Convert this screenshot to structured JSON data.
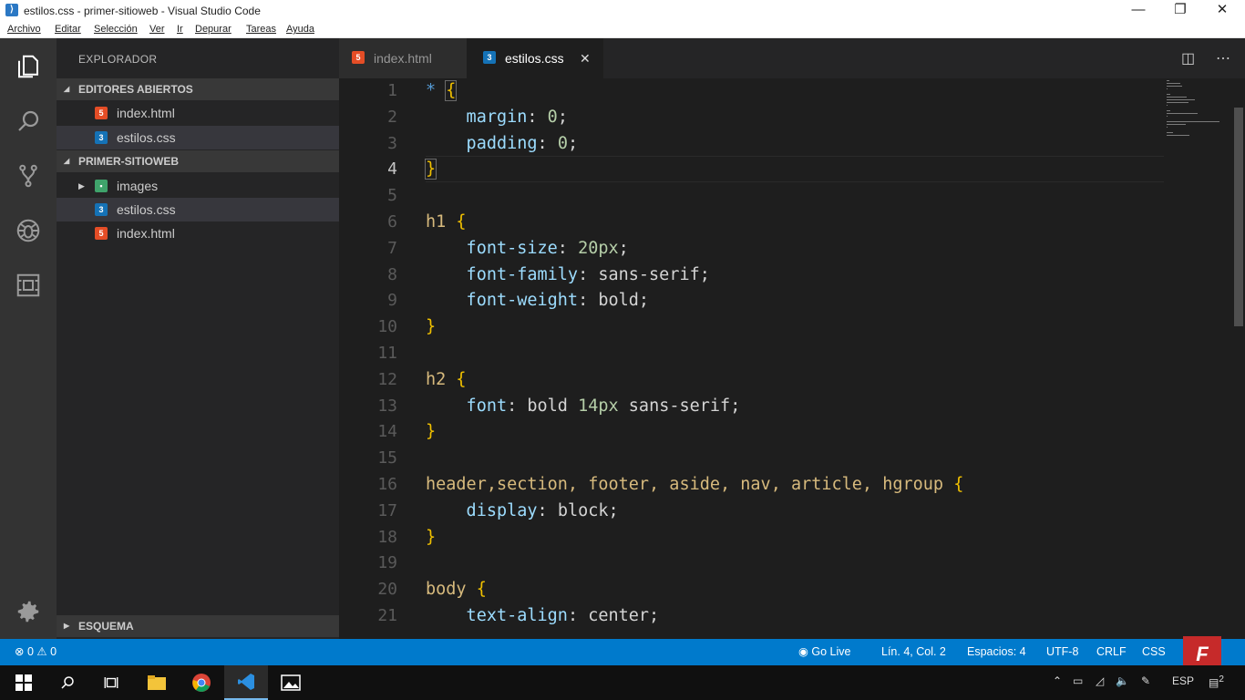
{
  "window": {
    "title": "estilos.css - primer-sitioweb - Visual Studio Code",
    "app_icon": "vscode-icon",
    "controls": {
      "minimize": "—",
      "maximize": "❐",
      "close": "✕"
    }
  },
  "menu": [
    "Archivo",
    "Editar",
    "Selección",
    "Ver",
    "Ir",
    "Depurar",
    "Tareas",
    "Ayuda"
  ],
  "activity_bar": [
    "explorer-icon",
    "search-icon",
    "source-control-icon",
    "debug-icon",
    "extensions-icon",
    "gear-icon"
  ],
  "sidebar": {
    "header": "EXPLORADOR",
    "open_editors": {
      "label": "EDITORES ABIERTOS",
      "files": [
        {
          "name": "index.html",
          "type": "html",
          "icon_text": "5"
        },
        {
          "name": "estilos.css",
          "type": "css",
          "icon_text": "3"
        }
      ]
    },
    "project": {
      "label": "PRIMER-SITIOWEB",
      "items": [
        {
          "name": "images",
          "type": "folder",
          "icon_text": "▪"
        },
        {
          "name": "estilos.css",
          "type": "css",
          "icon_text": "3"
        },
        {
          "name": "index.html",
          "type": "html",
          "icon_text": "5"
        }
      ]
    },
    "outline": {
      "label": "ESQUEMA"
    }
  },
  "tabs": [
    {
      "label": "index.html",
      "icon_text": "5",
      "type": "html"
    },
    {
      "label": "estilos.css",
      "icon_text": "3",
      "type": "css",
      "close": "✕"
    }
  ],
  "editor": {
    "current_line": 4,
    "lines": [
      {
        "n": "1",
        "tokens": [
          {
            "t": "* ",
            "c": "t-star"
          },
          {
            "t": "{",
            "c": "t-brace bracematch"
          }
        ]
      },
      {
        "n": "2",
        "tokens": [
          {
            "t": "    margin",
            "c": "t-prop"
          },
          {
            "t": ": ",
            "c": "t-punc"
          },
          {
            "t": "0",
            "c": "t-num"
          },
          {
            "t": ";",
            "c": "t-punc"
          }
        ]
      },
      {
        "n": "3",
        "tokens": [
          {
            "t": "    padding",
            "c": "t-prop"
          },
          {
            "t": ": ",
            "c": "t-punc"
          },
          {
            "t": "0",
            "c": "t-num"
          },
          {
            "t": ";",
            "c": "t-punc"
          }
        ]
      },
      {
        "n": "4",
        "tokens": [
          {
            "t": "}",
            "c": "t-brace bracematch"
          }
        ]
      },
      {
        "n": "5",
        "tokens": []
      },
      {
        "n": "6",
        "tokens": [
          {
            "t": "h1 ",
            "c": "t-sel"
          },
          {
            "t": "{",
            "c": "t-brace"
          }
        ]
      },
      {
        "n": "7",
        "tokens": [
          {
            "t": "    font-size",
            "c": "t-prop"
          },
          {
            "t": ": ",
            "c": "t-punc"
          },
          {
            "t": "20px",
            "c": "t-num"
          },
          {
            "t": ";",
            "c": "t-punc"
          }
        ]
      },
      {
        "n": "8",
        "tokens": [
          {
            "t": "    font-family",
            "c": "t-prop"
          },
          {
            "t": ": ",
            "c": "t-punc"
          },
          {
            "t": "sans-serif",
            "c": "t-val"
          },
          {
            "t": ";",
            "c": "t-punc"
          }
        ]
      },
      {
        "n": "9",
        "tokens": [
          {
            "t": "    font-weight",
            "c": "t-prop"
          },
          {
            "t": ": ",
            "c": "t-punc"
          },
          {
            "t": "bold",
            "c": "t-val"
          },
          {
            "t": ";",
            "c": "t-punc"
          }
        ]
      },
      {
        "n": "10",
        "tokens": [
          {
            "t": "}",
            "c": "t-brace"
          }
        ]
      },
      {
        "n": "11",
        "tokens": []
      },
      {
        "n": "12",
        "tokens": [
          {
            "t": "h2 ",
            "c": "t-sel"
          },
          {
            "t": "{",
            "c": "t-brace"
          }
        ]
      },
      {
        "n": "13",
        "tokens": [
          {
            "t": "    font",
            "c": "t-prop"
          },
          {
            "t": ": ",
            "c": "t-punc"
          },
          {
            "t": "bold ",
            "c": "t-val"
          },
          {
            "t": "14px",
            "c": "t-num"
          },
          {
            "t": " sans-serif",
            "c": "t-val"
          },
          {
            "t": ";",
            "c": "t-punc"
          }
        ]
      },
      {
        "n": "14",
        "tokens": [
          {
            "t": "}",
            "c": "t-brace"
          }
        ]
      },
      {
        "n": "15",
        "tokens": []
      },
      {
        "n": "16",
        "tokens": [
          {
            "t": "header,section, footer, aside, nav, article, hgroup ",
            "c": "t-sel"
          },
          {
            "t": "{",
            "c": "t-brace"
          }
        ]
      },
      {
        "n": "17",
        "tokens": [
          {
            "t": "    display",
            "c": "t-prop"
          },
          {
            "t": ": ",
            "c": "t-punc"
          },
          {
            "t": "block",
            "c": "t-val"
          },
          {
            "t": ";",
            "c": "t-punc"
          }
        ]
      },
      {
        "n": "18",
        "tokens": [
          {
            "t": "}",
            "c": "t-brace"
          }
        ]
      },
      {
        "n": "19",
        "tokens": []
      },
      {
        "n": "20",
        "tokens": [
          {
            "t": "body ",
            "c": "t-sel"
          },
          {
            "t": "{",
            "c": "t-brace"
          }
        ]
      },
      {
        "n": "21",
        "tokens": [
          {
            "t": "    text-align",
            "c": "t-prop"
          },
          {
            "t": ": ",
            "c": "t-punc"
          },
          {
            "t": "center",
            "c": "t-val"
          },
          {
            "t": ";",
            "c": "t-punc"
          }
        ]
      }
    ]
  },
  "statusbar": {
    "errors": "0",
    "warnings": "0",
    "golive": "Go Live",
    "position": "Lín. 4, Col. 2",
    "spaces": "Espacios: 4",
    "encoding": "UTF-8",
    "eol": "CRLF",
    "language": "CSS"
  },
  "taskbar": {
    "apps": [
      "windows-start-icon",
      "search-icon",
      "task-view-icon",
      "file-explorer-icon",
      "chrome-icon",
      "vscode-icon",
      "photos-icon"
    ],
    "tray_lang": "ESP",
    "notification_count": "2"
  },
  "colors": {
    "accent": "#007acc",
    "editor_bg": "#1e1e1e",
    "sidebar_bg": "#252526",
    "activity_bg": "#333333"
  }
}
